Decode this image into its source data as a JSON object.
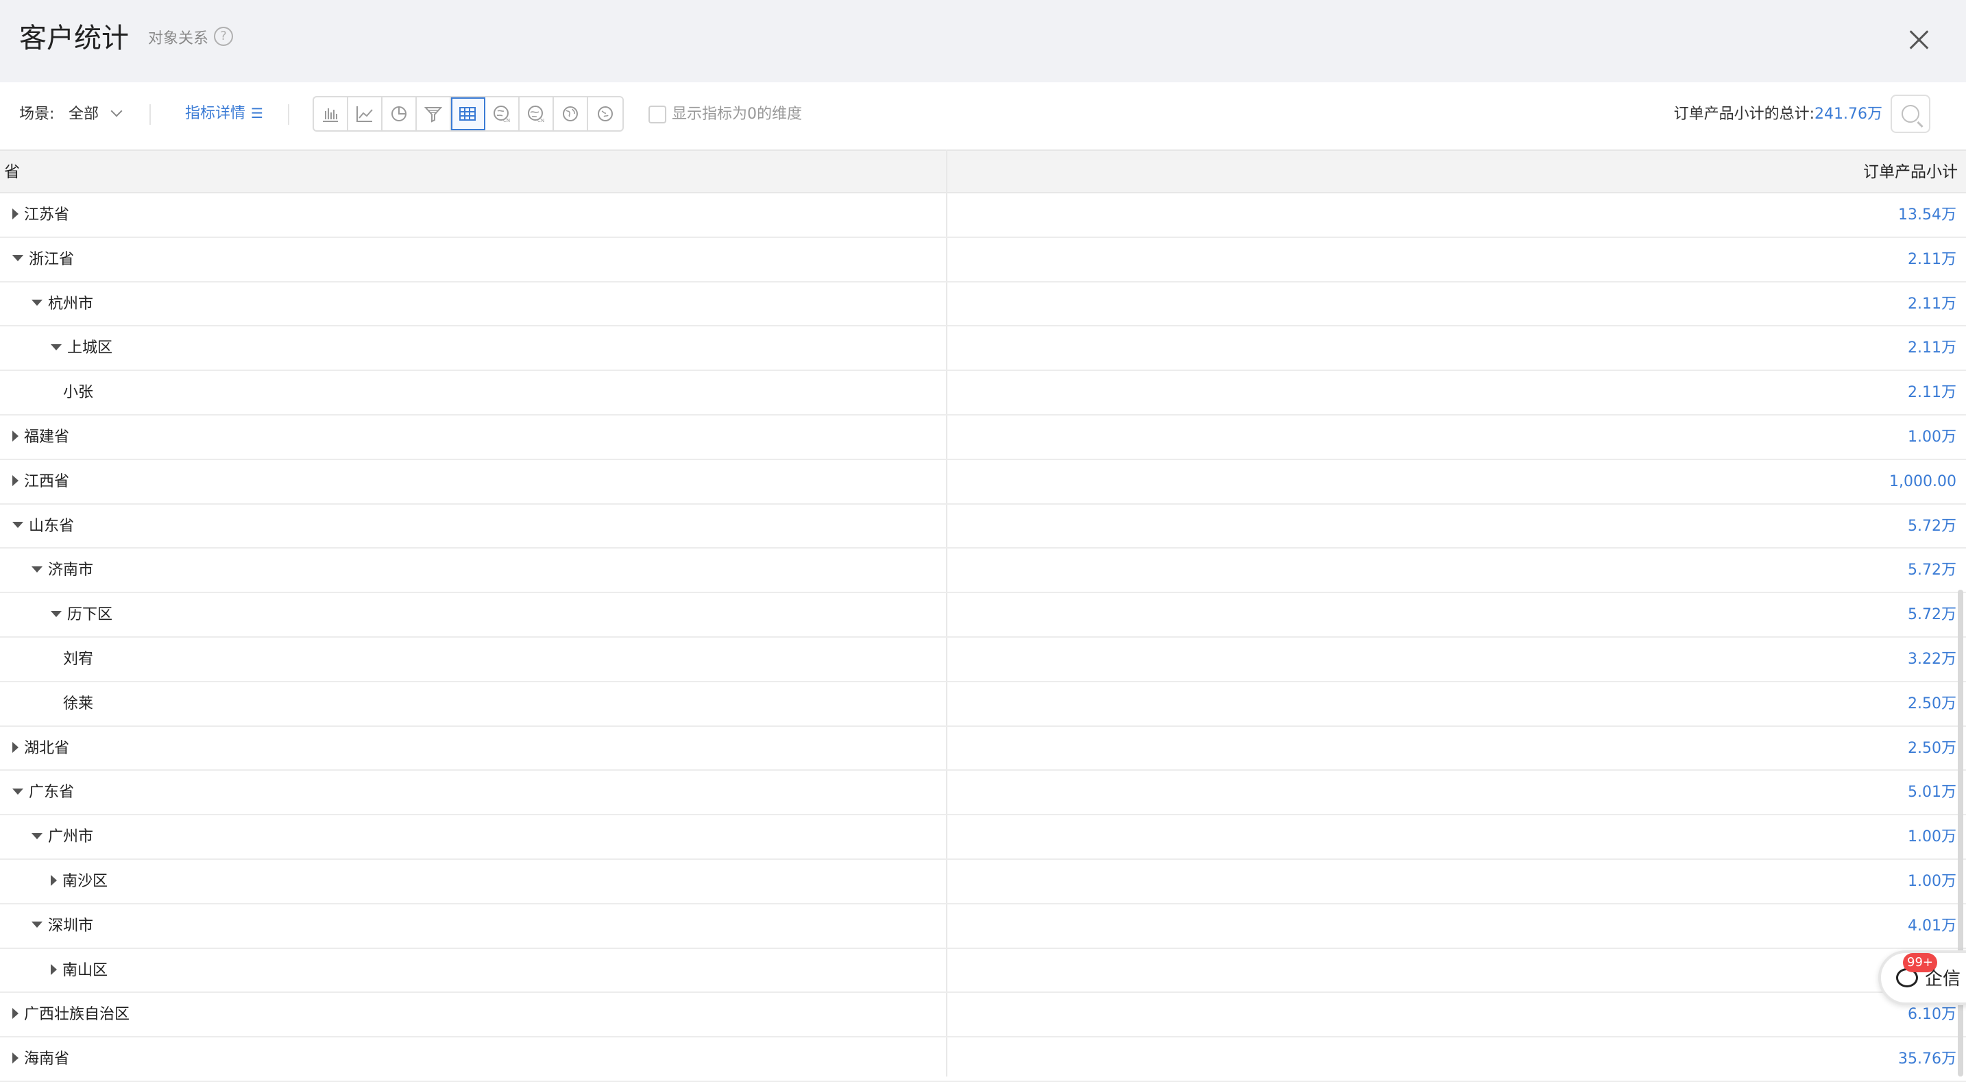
{
  "header": {
    "title": "客户统计",
    "subtitle": "对象关系",
    "help_glyph": "?"
  },
  "toolbar": {
    "scene_label": "场景:",
    "scene_value": "全部",
    "metric_details": "指标详情",
    "metric_details_icon": "list-icon",
    "chart_types": [
      {
        "icon": "bar-chart-icon"
      },
      {
        "icon": "line-chart-icon"
      },
      {
        "icon": "pie-chart-icon"
      },
      {
        "icon": "funnel-chart-icon"
      },
      {
        "icon": "table-icon",
        "active": true
      },
      {
        "icon": "china-map-icon"
      },
      {
        "icon": "china-map-alt-icon"
      },
      {
        "icon": "world-map-icon"
      },
      {
        "icon": "world-map-alt-icon"
      }
    ],
    "show_zero_label": "显示指标为0的维度",
    "total_label": "订单产品小计的总计:",
    "total_value": "241.76万"
  },
  "table": {
    "col_dimension": "省",
    "col_metric": "订单产品小计",
    "rows": [
      {
        "name": "江苏省",
        "level": 0,
        "toggle": "collapsed",
        "value": "13.54万"
      },
      {
        "name": "浙江省",
        "level": 0,
        "toggle": "expanded",
        "value": "2.11万"
      },
      {
        "name": "杭州市",
        "level": 1,
        "toggle": "expanded",
        "value": "2.11万"
      },
      {
        "name": "上城区",
        "level": 2,
        "toggle": "expanded",
        "value": "2.11万"
      },
      {
        "name": "小张",
        "level": 3,
        "toggle": "none",
        "value": "2.11万"
      },
      {
        "name": "福建省",
        "level": 0,
        "toggle": "collapsed",
        "value": "1.00万"
      },
      {
        "name": "江西省",
        "level": 0,
        "toggle": "collapsed",
        "value": "1,000.00"
      },
      {
        "name": "山东省",
        "level": 0,
        "toggle": "expanded",
        "value": "5.72万"
      },
      {
        "name": "济南市",
        "level": 1,
        "toggle": "expanded",
        "value": "5.72万"
      },
      {
        "name": "历下区",
        "level": 2,
        "toggle": "expanded",
        "value": "5.72万"
      },
      {
        "name": "刘宥",
        "level": 3,
        "toggle": "none",
        "value": "3.22万"
      },
      {
        "name": "徐莱",
        "level": 3,
        "toggle": "none",
        "value": "2.50万"
      },
      {
        "name": "湖北省",
        "level": 0,
        "toggle": "collapsed",
        "value": "2.50万"
      },
      {
        "name": "广东省",
        "level": 0,
        "toggle": "expanded",
        "value": "5.01万"
      },
      {
        "name": "广州市",
        "level": 1,
        "toggle": "expanded",
        "value": "1.00万"
      },
      {
        "name": "南沙区",
        "level": 2,
        "toggle": "collapsed",
        "value": "1.00万"
      },
      {
        "name": "深圳市",
        "level": 1,
        "toggle": "expanded",
        "value": "4.01万"
      },
      {
        "name": "南山区",
        "level": 2,
        "toggle": "collapsed",
        "value": ""
      },
      {
        "name": "广西壮族自治区",
        "level": 0,
        "toggle": "collapsed",
        "value": "6.10万"
      },
      {
        "name": "海南省",
        "level": 0,
        "toggle": "collapsed",
        "value": "35.76万"
      }
    ]
  },
  "qixin": {
    "label": "企信",
    "badge": "99+"
  },
  "colors": {
    "accent": "#3a7bd5",
    "header_bg": "#f1f2f5",
    "badge": "#f04747"
  }
}
